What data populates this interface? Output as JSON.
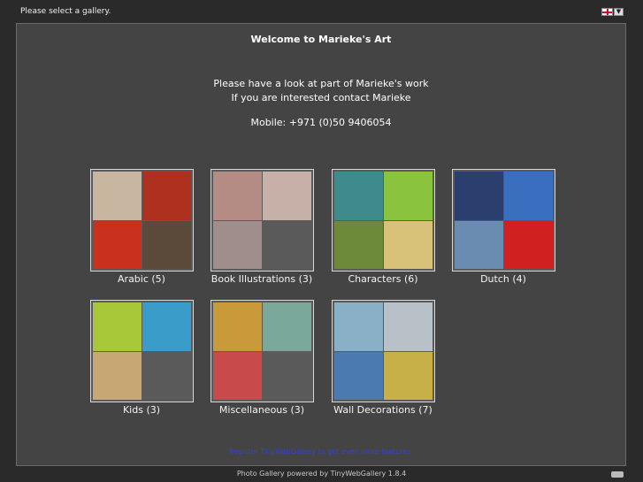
{
  "topbar": {
    "status_text": "Please select a gallery.",
    "language_icon": "uk-flag-icon",
    "dropdown_icon": "chevron-down-icon"
  },
  "panel": {
    "welcome_title": "Welcome to Marieke's Art",
    "intro_line1": "Please have a look at part of Marieke's work",
    "intro_line2": "If you are interested contact Marieke",
    "mobile": "Mobile: +971 (0)50 9406054"
  },
  "galleries": [
    {
      "label": "Arabic (5)",
      "tiles": [
        "#c9b6a0",
        "#b03020",
        "#c9301e",
        "#5b4a3a"
      ]
    },
    {
      "label": "Book Illustrations (3)",
      "tiles": [
        "#b58c84",
        "#c7b0a8",
        "#a08e8c",
        ""
      ]
    },
    {
      "label": "Characters (6)",
      "tiles": [
        "#3f8a8a",
        "#8ac43f",
        "#6c8a3a",
        "#d8c27a"
      ]
    },
    {
      "label": "Dutch (4)",
      "tiles": [
        "#2a3f6e",
        "#3a6ebf",
        "#6a8cb0",
        "#d02020"
      ]
    },
    {
      "label": "Kids (3)",
      "tiles": [
        "#a8c83a",
        "#3a9cc8",
        "#c8a872",
        ""
      ]
    },
    {
      "label": "Miscellaneous (3)",
      "tiles": [
        "#c89a3a",
        "#7aa89a",
        "#c84a4a",
        ""
      ]
    },
    {
      "label": "Wall Decorations (7)",
      "tiles": [
        "#8ab0c8",
        "#b8c0c8",
        "#4a7ab0",
        "#c8b048"
      ]
    }
  ],
  "register_link": "Register TinyWebGallery to get even more features.",
  "footer": "Photo Gallery powered by TinyWebGallery 1.8.4",
  "colors": {
    "background": "#2a2a2a",
    "panel": "#444444",
    "link": "#3344cc"
  }
}
